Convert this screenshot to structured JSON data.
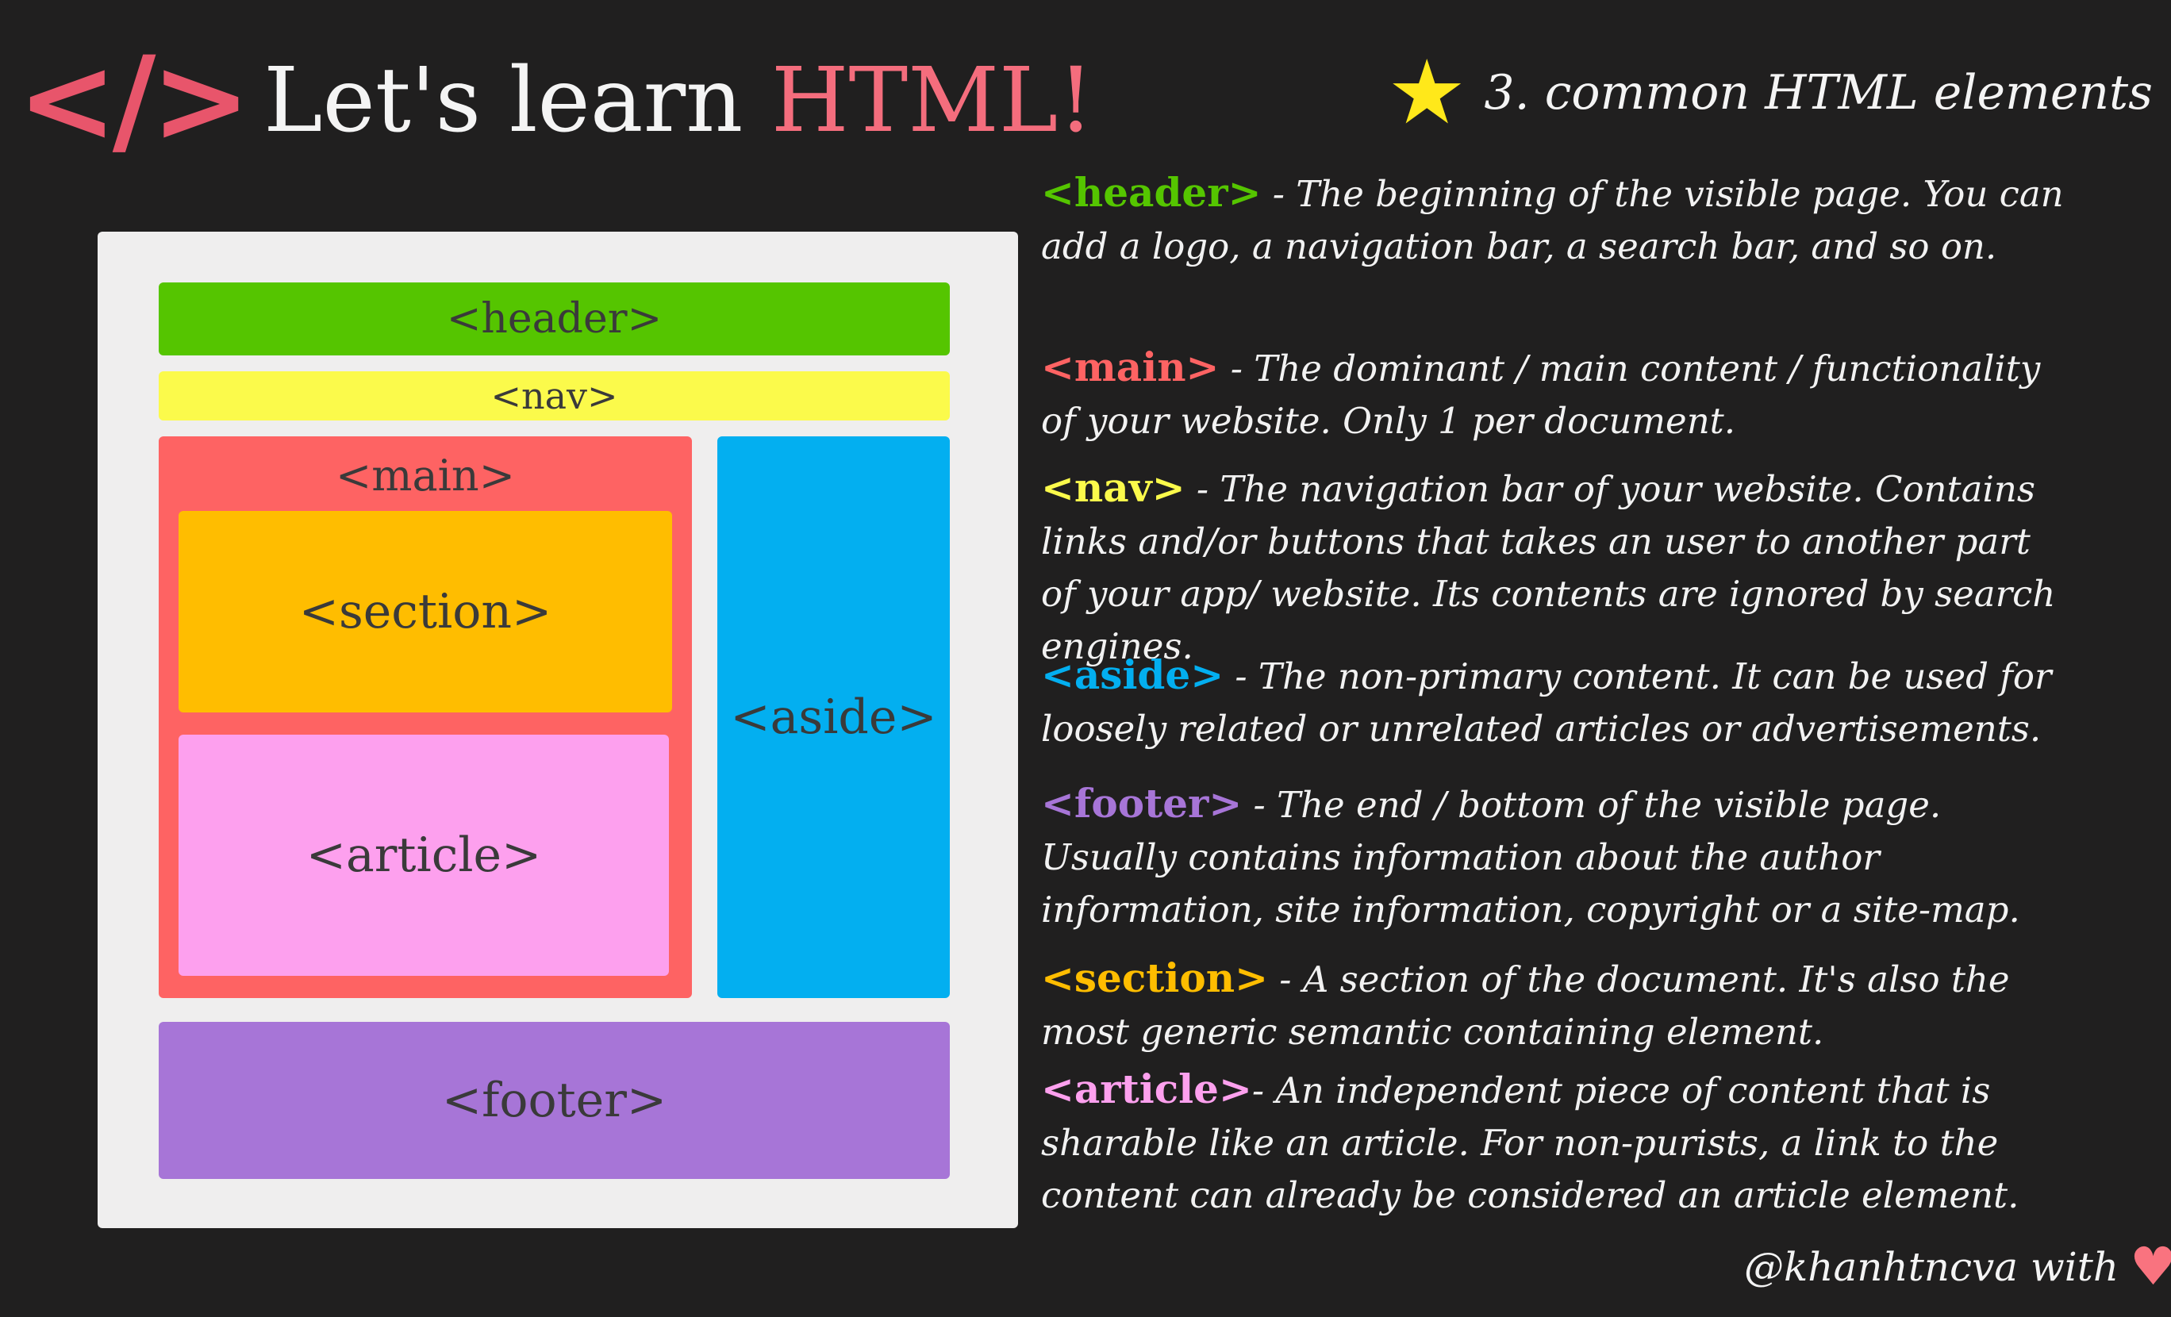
{
  "title": {
    "code_icon": "</>",
    "prefix": "Let's learn ",
    "highlight": "HTML!"
  },
  "subtitle": {
    "star": "★",
    "text": "3. common HTML elements"
  },
  "diagram": {
    "header": "<header>",
    "nav": "<nav>",
    "main": "<main>",
    "section": "<section>",
    "article": "<article>",
    "aside": "<aside>",
    "footer": "<footer>"
  },
  "descriptions": [
    {
      "tag": "<header>",
      "text": " - The beginning of the visible page. You can add a logo, a navigation bar, a search bar, and so on.",
      "color": "#55c500"
    },
    {
      "tag": "<main>",
      "text": " - The dominant / main content / functionality of your website. Only 1 per document.",
      "color": "#fe6363"
    },
    {
      "tag": "<nav>",
      "text": " - The navigation bar of your website. Contains links and/or buttons that takes an user to another part of your app/ website. Its contents are ignored by search engines.",
      "color": "#fbfa4b"
    },
    {
      "tag": "<aside>",
      "text": " - The non-primary content. It can be used for loosely related or unrelated articles or advertisements.",
      "color": "#03aff0"
    },
    {
      "tag": "<footer>",
      "text": " - The end / bottom of the visible page. Usually contains information about the author information, site information, copyright or a site-map.",
      "color": "#a775d7"
    },
    {
      "tag": "<section>",
      "text": " - A section of the document. It's also the most generic semantic containing element.",
      "color": "#ffbd00"
    },
    {
      "tag": "<article>",
      "text": "- An independent piece of content that is sharable like an article. For non-purists, a link to the content can already be considered an article element.",
      "color": "#fda0ee"
    }
  ],
  "signature": {
    "text": "@khanhtncva with",
    "heart": "♥"
  },
  "colors": {
    "background": "#201f1f",
    "title_accent": "#f46d7d",
    "code_icon": "#e8556b",
    "star": "#ffe81a",
    "heart": "#f9737f",
    "paper": "#efeeee"
  }
}
